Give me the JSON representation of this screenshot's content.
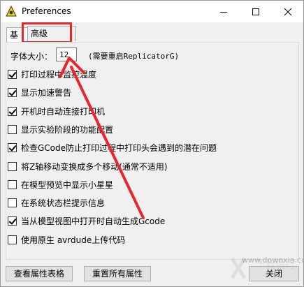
{
  "window": {
    "title": "Preferences"
  },
  "tabs": [
    {
      "label": "基础"
    },
    {
      "label": "高级"
    }
  ],
  "font_size": {
    "label": "字体大小：",
    "value": "12",
    "note": "(需要重启ReplicatorG)"
  },
  "options": [
    {
      "label": "打印过程中监控温度",
      "checked": true
    },
    {
      "label": "显示加速警告",
      "checked": true
    },
    {
      "label": "开机时自动连接打印机",
      "checked": true
    },
    {
      "label": "显示实验阶段的功能配置",
      "checked": false
    },
    {
      "label": "检查GCode防止打印过程中打印头会遇到的潜在问题",
      "checked": true
    },
    {
      "label": "将Z轴移动变换成多个移动(通常不适用)",
      "checked": false
    },
    {
      "label": "在模型预览中显示小星星",
      "checked": false
    },
    {
      "label": "在系统状态栏提示信息",
      "checked": false
    },
    {
      "label": "当从模型视图中打开时自动生成Gcode",
      "checked": true
    },
    {
      "label": "使用原生 avrdude上传代码",
      "checked": false
    }
  ],
  "buttons": {
    "properties": "查看属性表格",
    "reset": "重置所有属性",
    "close": "关闭"
  },
  "watermark": {
    "text": "www.downxia.com"
  },
  "colors": {
    "annotation_red": "#e8262c",
    "titlebar": "#ffffff",
    "panel": "#f0f0f0"
  }
}
